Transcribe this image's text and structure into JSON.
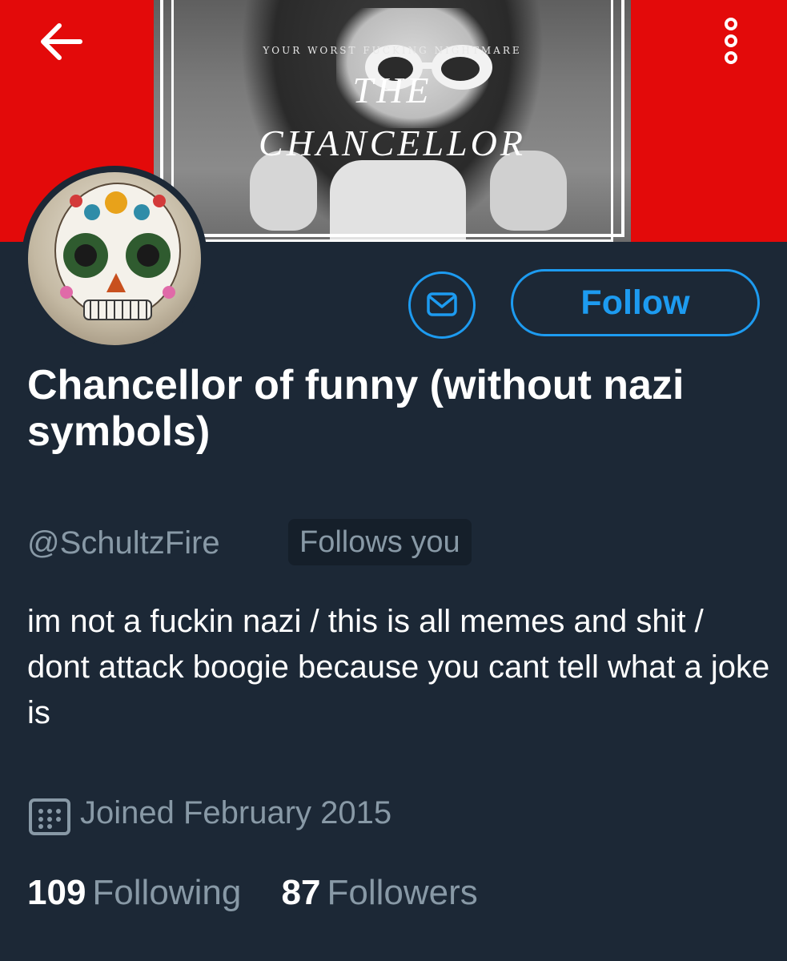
{
  "header": {
    "banner_tagline": "YOUR WORST FUCKING NIGHTMARE",
    "banner_title_line1": "THE",
    "banner_title_line2": "CHANCELLOR"
  },
  "actions": {
    "follow_label": "Follow"
  },
  "profile": {
    "display_name": "Chancellor of funny (without nazi symbols)",
    "handle": "@SchultzFire",
    "follows_you_badge": "Follows you",
    "bio": "im not a fuckin nazi / this is all memes and shit / dont attack boogie because you cant tell what a joke is",
    "joined": "Joined February 2015"
  },
  "stats": {
    "following_count": "109",
    "following_label": "Following",
    "followers_count": "87",
    "followers_label": "Followers"
  },
  "colors": {
    "background": "#1c2836",
    "accent": "#1d9bf0",
    "secondary_text": "#8899a6",
    "banner_red": "#e30a0a"
  }
}
